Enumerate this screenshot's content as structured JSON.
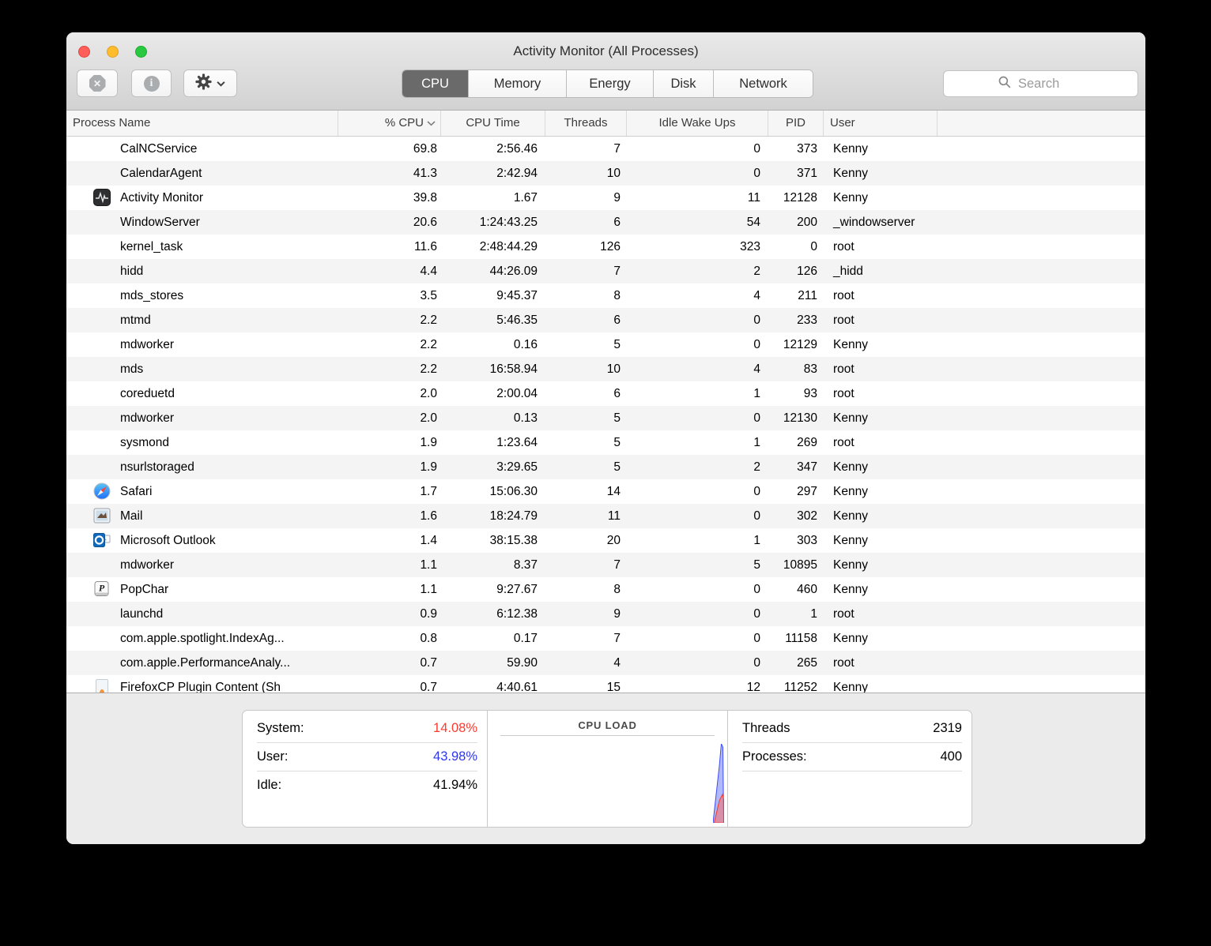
{
  "window": {
    "title": "Activity Monitor (All Processes)"
  },
  "toolbar": {
    "buttons": [
      {
        "name": "quit-process",
        "icon": "octagon-x-icon"
      },
      {
        "name": "inspect-process",
        "icon": "info-icon"
      },
      {
        "name": "view-options",
        "icon": "gear-icon"
      }
    ],
    "tabs": [
      {
        "label": "CPU",
        "selected": true
      },
      {
        "label": "Memory",
        "selected": false
      },
      {
        "label": "Energy",
        "selected": false
      },
      {
        "label": "Disk",
        "selected": false
      },
      {
        "label": "Network",
        "selected": false
      }
    ],
    "search_placeholder": "Search"
  },
  "table": {
    "columns": [
      "Process Name",
      "% CPU",
      "CPU Time",
      "Threads",
      "Idle Wake Ups",
      "PID",
      "User"
    ],
    "sort_column": "% CPU",
    "sort_direction": "descending",
    "rows": [
      {
        "name": "CalNCService",
        "icon": null,
        "cpu": "69.8",
        "time": "2:56.46",
        "threads": "7",
        "idle": "0",
        "pid": "373",
        "user": "Kenny"
      },
      {
        "name": "CalendarAgent",
        "icon": null,
        "cpu": "41.3",
        "time": "2:42.94",
        "threads": "10",
        "idle": "0",
        "pid": "371",
        "user": "Kenny"
      },
      {
        "name": "Activity Monitor",
        "icon": "activity-monitor",
        "cpu": "39.8",
        "time": "1.67",
        "threads": "9",
        "idle": "11",
        "pid": "12128",
        "user": "Kenny"
      },
      {
        "name": "WindowServer",
        "icon": null,
        "cpu": "20.6",
        "time": "1:24:43.25",
        "threads": "6",
        "idle": "54",
        "pid": "200",
        "user": "_windowserver"
      },
      {
        "name": "kernel_task",
        "icon": null,
        "cpu": "11.6",
        "time": "2:48:44.29",
        "threads": "126",
        "idle": "323",
        "pid": "0",
        "user": "root"
      },
      {
        "name": "hidd",
        "icon": null,
        "cpu": "4.4",
        "time": "44:26.09",
        "threads": "7",
        "idle": "2",
        "pid": "126",
        "user": "_hidd"
      },
      {
        "name": "mds_stores",
        "icon": null,
        "cpu": "3.5",
        "time": "9:45.37",
        "threads": "8",
        "idle": "4",
        "pid": "211",
        "user": "root"
      },
      {
        "name": "mtmd",
        "icon": null,
        "cpu": "2.2",
        "time": "5:46.35",
        "threads": "6",
        "idle": "0",
        "pid": "233",
        "user": "root"
      },
      {
        "name": "mdworker",
        "icon": null,
        "cpu": "2.2",
        "time": "0.16",
        "threads": "5",
        "idle": "0",
        "pid": "12129",
        "user": "Kenny"
      },
      {
        "name": "mds",
        "icon": null,
        "cpu": "2.2",
        "time": "16:58.94",
        "threads": "10",
        "idle": "4",
        "pid": "83",
        "user": "root"
      },
      {
        "name": "coreduetd",
        "icon": null,
        "cpu": "2.0",
        "time": "2:00.04",
        "threads": "6",
        "idle": "1",
        "pid": "93",
        "user": "root"
      },
      {
        "name": "mdworker",
        "icon": null,
        "cpu": "2.0",
        "time": "0.13",
        "threads": "5",
        "idle": "0",
        "pid": "12130",
        "user": "Kenny"
      },
      {
        "name": "sysmond",
        "icon": null,
        "cpu": "1.9",
        "time": "1:23.64",
        "threads": "5",
        "idle": "1",
        "pid": "269",
        "user": "root"
      },
      {
        "name": "nsurlstoraged",
        "icon": null,
        "cpu": "1.9",
        "time": "3:29.65",
        "threads": "5",
        "idle": "2",
        "pid": "347",
        "user": "Kenny"
      },
      {
        "name": "Safari",
        "icon": "safari",
        "cpu": "1.7",
        "time": "15:06.30",
        "threads": "14",
        "idle": "0",
        "pid": "297",
        "user": "Kenny"
      },
      {
        "name": "Mail",
        "icon": "mail",
        "cpu": "1.6",
        "time": "18:24.79",
        "threads": "11",
        "idle": "0",
        "pid": "302",
        "user": "Kenny"
      },
      {
        "name": "Microsoft Outlook",
        "icon": "outlook",
        "cpu": "1.4",
        "time": "38:15.38",
        "threads": "20",
        "idle": "1",
        "pid": "303",
        "user": "Kenny"
      },
      {
        "name": "mdworker",
        "icon": null,
        "cpu": "1.1",
        "time": "8.37",
        "threads": "7",
        "idle": "5",
        "pid": "10895",
        "user": "Kenny"
      },
      {
        "name": "PopChar",
        "icon": "popchar",
        "cpu": "1.1",
        "time": "9:27.67",
        "threads": "8",
        "idle": "0",
        "pid": "460",
        "user": "Kenny"
      },
      {
        "name": "launchd",
        "icon": null,
        "cpu": "0.9",
        "time": "6:12.38",
        "threads": "9",
        "idle": "0",
        "pid": "1",
        "user": "root"
      },
      {
        "name": "com.apple.spotlight.IndexAg...",
        "icon": null,
        "cpu": "0.8",
        "time": "0.17",
        "threads": "7",
        "idle": "0",
        "pid": "11158",
        "user": "Kenny"
      },
      {
        "name": "com.apple.PerformanceAnaly...",
        "icon": null,
        "cpu": "0.7",
        "time": "59.90",
        "threads": "4",
        "idle": "0",
        "pid": "265",
        "user": "root"
      },
      {
        "name": "FirefoxCP Plugin Content (Sh",
        "icon": "firefox-plugin",
        "cpu": "0.7",
        "time": "4:40.61",
        "threads": "15",
        "idle": "12",
        "pid": "11252",
        "user": "Kenny"
      }
    ]
  },
  "footer": {
    "stats": [
      {
        "label": "System:",
        "value": "14.08%",
        "color": "#fb3b30"
      },
      {
        "label": "User:",
        "value": "43.98%",
        "color": "#2f36f0"
      },
      {
        "label": "Idle:",
        "value": "41.94%",
        "color": "#000000"
      }
    ],
    "graph_title": "CPU LOAD",
    "graph_colors": {
      "user_load": "#3d4df2",
      "system_load": "#f23a2e"
    },
    "counters": [
      {
        "label": "Threads",
        "value": "2319"
      },
      {
        "label": "Processes:",
        "value": "400"
      }
    ]
  }
}
